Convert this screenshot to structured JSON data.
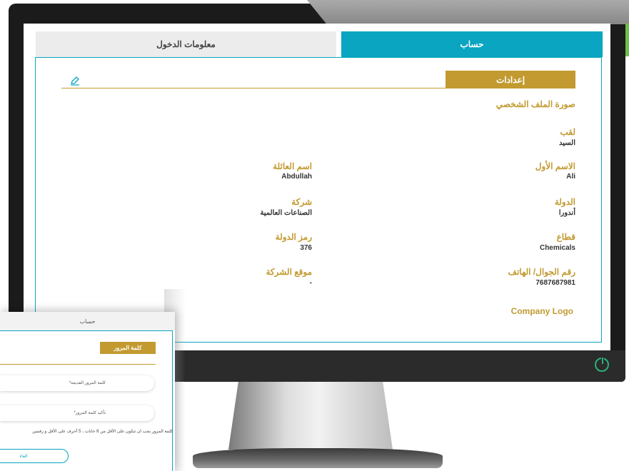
{
  "tabs": {
    "account": "حساب",
    "login_info": "معلومات الدخول"
  },
  "settings": {
    "header": "إعدادات"
  },
  "profile": {
    "picture_label": "صورة الملف الشخصي",
    "title": {
      "label": "لقب",
      "value": "السيد"
    },
    "first_name": {
      "label": "الاسم الأول",
      "value": "Ali"
    },
    "family_name": {
      "label": "اسم العائلة",
      "value": "Abdullah"
    },
    "country": {
      "label": "الدولة",
      "value": "أندورا"
    },
    "company": {
      "label": "شركة",
      "value": "الصناعات العالمية"
    },
    "sector": {
      "label": "قطاع",
      "value": "Chemicals"
    },
    "country_code": {
      "label": "رمز الدولة",
      "value": "376"
    },
    "phone": {
      "label": "رقم الجوال/ الهاتف",
      "value": "7687687981"
    },
    "company_website": {
      "label": "موقع الشركة",
      "value": "-"
    },
    "company_logo": "Company Logo"
  },
  "password_card": {
    "header": "حساب",
    "tab": "كلمة المرور",
    "old_password_label": "كلمة المرور القديمة*",
    "confirm_password_label": "تأكيد كلمة المرور*",
    "help_text": "كلمة المرور يجب ان تتكون على الأقل من 8 خانات ، 5 أحرف على الأقل و رقمين",
    "cancel_label": "الغاء"
  },
  "colors": {
    "accent": "#0aa5c0",
    "gold": "#c29a30",
    "power": "#2bb07a"
  },
  "icons": {
    "edit": "pencil-icon",
    "power": "power-icon"
  }
}
